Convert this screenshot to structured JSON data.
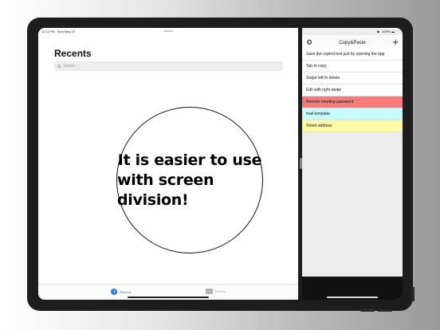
{
  "left": {
    "status_time": "11:12 PM",
    "status_date": "Mon May 23",
    "title": "Recents",
    "search_placeholder": "Search",
    "promo_line1": "It is easier to use",
    "promo_line2": "with screen division!",
    "tabs": [
      {
        "label": "Recents",
        "icon": "clock-icon",
        "active": true
      },
      {
        "label": "Browse",
        "icon": "folder-icon",
        "active": false
      }
    ]
  },
  "right": {
    "status_battery": "100%",
    "title": "Copy&Paste",
    "gear_icon": "gear-icon",
    "plus_icon": "plus-icon",
    "rows": [
      {
        "text": "Save the copied text just by opening the app",
        "color": "#ffffff"
      },
      {
        "text": "Tap to copy",
        "color": "#ffffff"
      },
      {
        "text": "Swipe left to delete",
        "color": "#ffffff"
      },
      {
        "text": "Edit with right swipe",
        "color": "#ffffff"
      },
      {
        "text": "Remote meeting password",
        "color": "#f77b7b"
      },
      {
        "text": "mail template",
        "color": "#c8fbfb"
      },
      {
        "text": "Street address",
        "color": "#fdfaa6"
      }
    ]
  },
  "colors": {
    "accent": "#2f7cf6"
  }
}
